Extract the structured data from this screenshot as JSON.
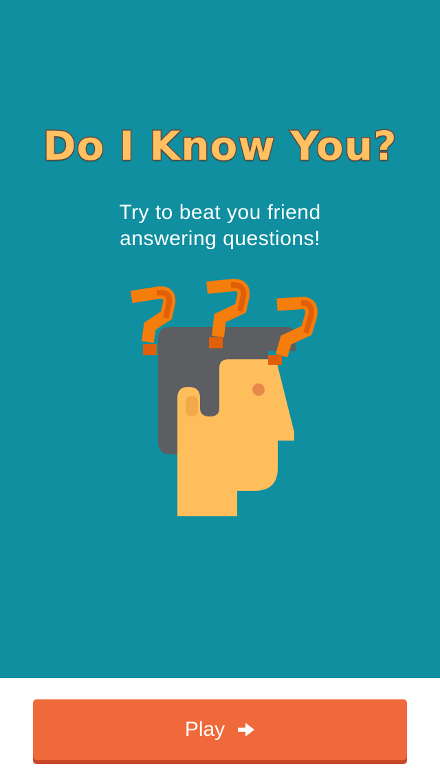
{
  "app": {
    "title": "Do I Know You?",
    "subtitle_lines": [
      "Try to beat you friend",
      "answering questions!"
    ]
  },
  "illustration": {
    "icon": "confused-head-icon",
    "colors": {
      "hair": "#5c5e61",
      "skin": "#ffbe5c",
      "ear_inner": "#f2a94a",
      "eye": "#e8894b",
      "question_marks": "#f57d0b",
      "question_marks_dark": "#e25f09"
    }
  },
  "footer": {
    "play_label": "Play",
    "play_icon": "arrow-right-icon"
  },
  "colors": {
    "background": "#0f8fa0",
    "title": "#ffc162",
    "title_outline": "#6b4a3a",
    "button": "#f0693a",
    "button_shadow": "#c8482a"
  }
}
